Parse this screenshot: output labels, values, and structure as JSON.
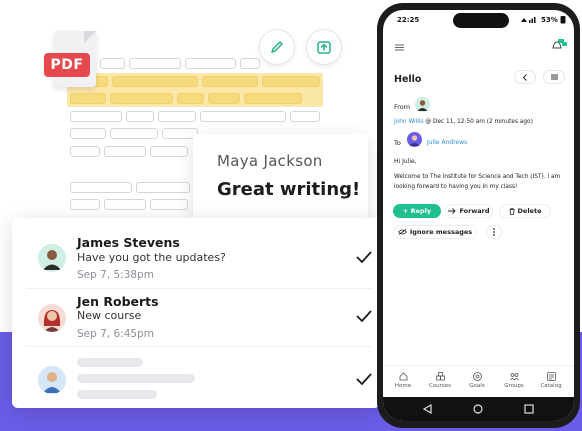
{
  "document": {
    "badge": "PDF"
  },
  "quote_card": {
    "name": "Maya Jackson",
    "text": "Great writing!"
  },
  "messages": [
    {
      "name": "James Stevens",
      "text": "Have you got the updates?",
      "time": "Sep 7, 5:38pm"
    },
    {
      "name": "Jen Roberts",
      "text": "New course",
      "time": "Sep 7, 6:45pm"
    }
  ],
  "phone": {
    "status": {
      "time": "22:25",
      "battery": "53%"
    },
    "header": {
      "title": "Hello"
    },
    "email": {
      "from_label": "From",
      "sender": "John Willis",
      "sent_at": "@ Dec 11, 12:50 am (2 minutes ago)",
      "to_label": "To",
      "recipient": "Julie Andrews",
      "greeting": "Hi Julie,",
      "body": "Welcome to The Institute for Science and Tech (IST). I am looking forward to having you in my class!"
    },
    "actions": {
      "reply": "+ Reply",
      "forward": "Forward",
      "delete": "Delete",
      "ignore": "Ignore messages"
    },
    "nav": [
      {
        "label": "Home",
        "icon": "home-icon"
      },
      {
        "label": "Courses",
        "icon": "courses-icon"
      },
      {
        "label": "Goals",
        "icon": "goals-icon"
      },
      {
        "label": "Groups",
        "icon": "groups-icon"
      },
      {
        "label": "Catalog",
        "icon": "catalog-icon"
      }
    ],
    "colors": {
      "accent": "#1fbf8f",
      "link": "#2f8fd6"
    }
  },
  "colors": {
    "brand_purple": "#6b5ce7",
    "pdf_red": "#e5484d",
    "highlight": "#f7d97e"
  }
}
